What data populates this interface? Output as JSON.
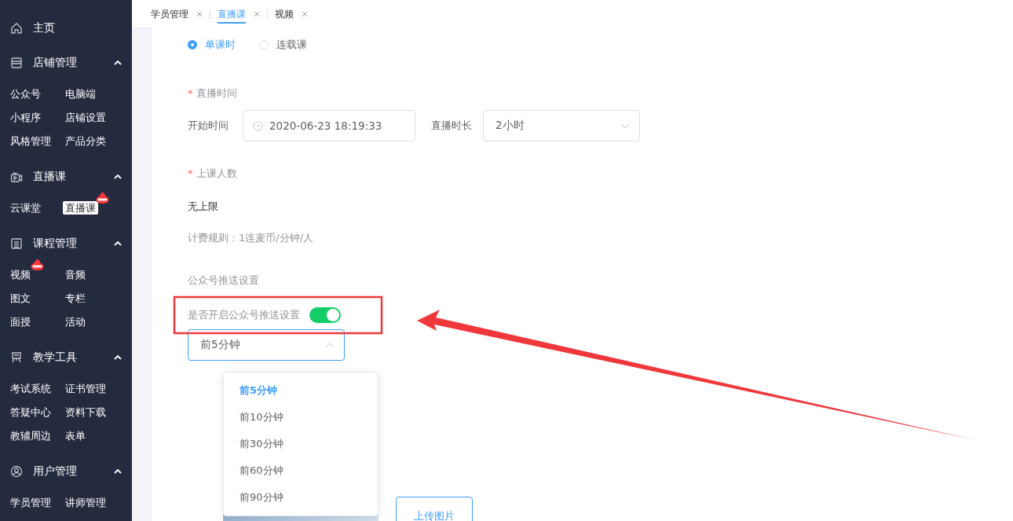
{
  "sidebar": {
    "sections": [
      {
        "label": "主页"
      },
      {
        "label": "店铺管理",
        "expanded": true,
        "items": [
          {
            "label": "公众号",
            "selected": false,
            "hot": false
          },
          {
            "label": "电脑端",
            "selected": false,
            "hot": false
          },
          {
            "label": "小程序",
            "selected": false,
            "hot": false
          },
          {
            "label": "店铺设置",
            "selected": false,
            "hot": false
          },
          {
            "label": "风格管理",
            "selected": false,
            "hot": false
          },
          {
            "label": "产品分类",
            "selected": false,
            "hot": false
          }
        ]
      },
      {
        "label": "直播课",
        "expanded": true,
        "items": [
          {
            "label": "云课堂",
            "selected": false,
            "hot": false
          },
          {
            "label": "直播课",
            "selected": true,
            "hot": true
          }
        ]
      },
      {
        "label": "课程管理",
        "expanded": true,
        "items": [
          {
            "label": "视频",
            "selected": false,
            "hot": true
          },
          {
            "label": "音频",
            "selected": false,
            "hot": false
          },
          {
            "label": "图文",
            "selected": false,
            "hot": false
          },
          {
            "label": "专栏",
            "selected": false,
            "hot": false
          },
          {
            "label": "面授",
            "selected": false,
            "hot": false
          },
          {
            "label": "活动",
            "selected": false,
            "hot": false
          }
        ]
      },
      {
        "label": "教学工具",
        "expanded": true,
        "items": [
          {
            "label": "考试系统",
            "selected": false,
            "hot": false
          },
          {
            "label": "证书管理",
            "selected": false,
            "hot": false
          },
          {
            "label": "答疑中心",
            "selected": false,
            "hot": false
          },
          {
            "label": "资料下载",
            "selected": false,
            "hot": false
          },
          {
            "label": "教辅周边",
            "selected": false,
            "hot": false
          },
          {
            "label": "表单",
            "selected": false,
            "hot": false
          }
        ]
      },
      {
        "label": "用户管理",
        "expanded": true,
        "items": [
          {
            "label": "学员管理",
            "selected": false,
            "hot": false
          },
          {
            "label": "讲师管理",
            "selected": false,
            "hot": false
          }
        ]
      }
    ]
  },
  "tabs": [
    {
      "label": "学员管理",
      "selected": false
    },
    {
      "label": "直播课",
      "selected": true
    },
    {
      "label": "视频",
      "selected": false
    }
  ],
  "form": {
    "course_type": [
      {
        "label": "单课时",
        "selected": true
      },
      {
        "label": "连载课",
        "selected": false
      }
    ],
    "live_time": {
      "label": "直播时间",
      "required_mark": "*",
      "start_label": "开始时间",
      "start_value": "2020-06-23 18:19:33",
      "duration_label": "直播时长",
      "duration_value": "2小时"
    },
    "capacity": {
      "label": "上课人数",
      "required_mark": "*",
      "value": "无上限",
      "note": "计费规则：1连麦币/分钟/人"
    },
    "push": {
      "heading": "公众号推送设置",
      "toggle_label": "是否开启公众号推送设置",
      "on": true,
      "select_value": "前5分钟",
      "options": [
        {
          "label": "前5分钟",
          "selected": true
        },
        {
          "label": "前10分钟",
          "selected": false
        },
        {
          "label": "前30分钟",
          "selected": false
        },
        {
          "label": "前60分钟",
          "selected": false
        },
        {
          "label": "前90分钟",
          "selected": false
        }
      ]
    },
    "upload_button": "上传图片"
  }
}
